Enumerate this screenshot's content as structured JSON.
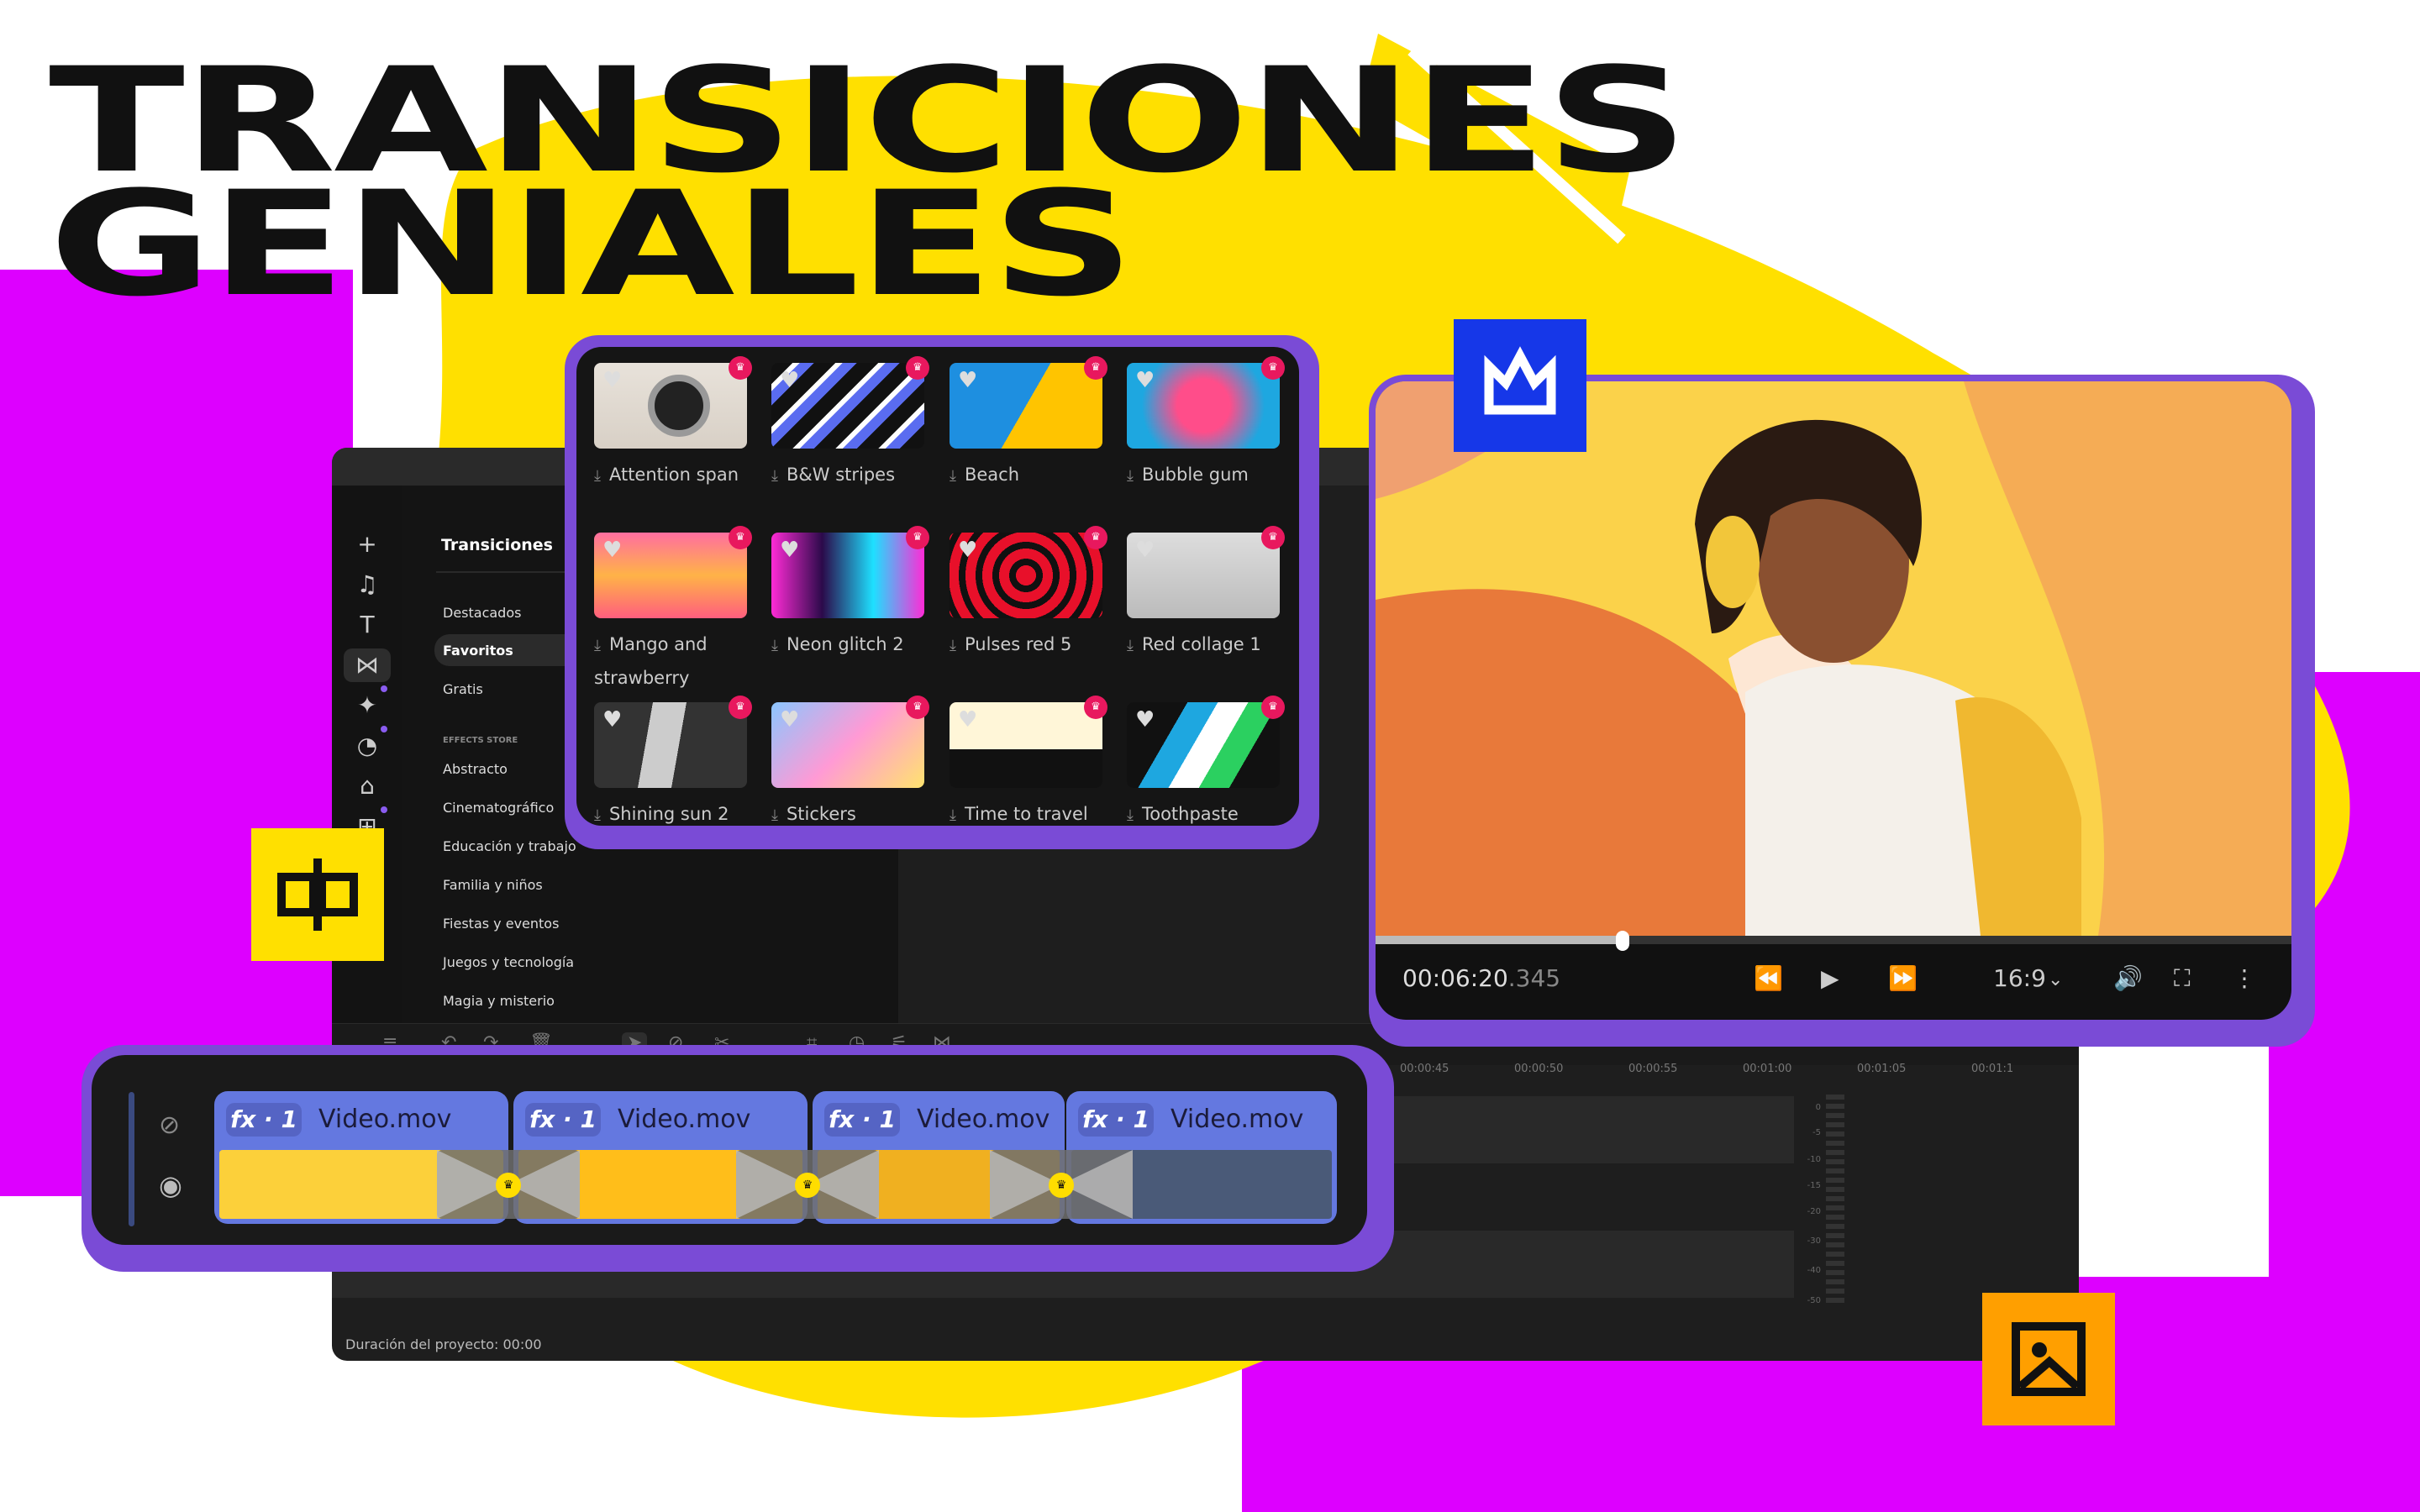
{
  "headline": {
    "line1": "TRANSICIONES",
    "line2": "GENIALES"
  },
  "colors": {
    "magenta": "#dd00ff",
    "yellow": "#ffe000",
    "purple": "#7a4bd6",
    "blue_badge": "#1637e8",
    "orange_badge": "#ff9f00",
    "clip_blue": "#6478e0",
    "premium_pink": "#e8185e"
  },
  "sidebar": {
    "icons": [
      "plus-icon",
      "music-icon",
      "text-icon",
      "transitions-icon",
      "effects-icon",
      "stickers-icon",
      "media-add-icon",
      "apps-icon"
    ]
  },
  "categories": {
    "title": "Transiciones",
    "items": [
      "Destacados",
      "Favoritos",
      "Gratis"
    ],
    "selected": "Favoritos",
    "store_label": "EFFECTS STORE",
    "store_items": [
      "Abstracto",
      "Cinematográfico",
      "Educación y trabajo",
      "Familia y niños",
      "Fiestas y eventos",
      "Juegos y tecnología",
      "Magia y misterio"
    ]
  },
  "effects": [
    {
      "name": "Attention span",
      "bg": "linear-gradient(#e8e2da,#d8d0c6)"
    },
    {
      "name": "B&W stripes",
      "bg": "repeating-linear-gradient(135deg,#111 0 18px,#fff 18px 24px,#5a6cf0 24px 36px)"
    },
    {
      "name": "Beach",
      "bg": "linear-gradient(120deg,#1e8fe0 50%,#ffc400 50%)"
    },
    {
      "name": "Bubble gum",
      "bg": "radial-gradient(circle at 50% 50%,#ff4d8a 30%,#1ea7e0 70%)"
    },
    {
      "name": "Mango and strawberry",
      "bg": "linear-gradient(#ff6ea0,#ffb347 50%,#ff5e7e)"
    },
    {
      "name": "Neon glitch 2",
      "bg": "linear-gradient(90deg,#ff2bd6,#2b0a4a,#1ee0ff,#ff2bd6)"
    },
    {
      "name": "Pulses red 5",
      "bg": "repeating-radial-gradient(circle,#e8102a 0 12px,#111 12px 20px)"
    },
    {
      "name": "Red collage 1",
      "bg": "linear-gradient(#ddd,#bbb)"
    },
    {
      "name": "Shining sun 2",
      "bg": "linear-gradient(100deg,#333 35%,#ccc 35% 55%,#333 55%)"
    },
    {
      "name": "Stickers",
      "bg": "linear-gradient(135deg,#8bc6ff,#ff9ad5,#ffe36e)"
    },
    {
      "name": "Time to travel",
      "bg": "linear-gradient(#fff6d8 55%,#111 55%)"
    },
    {
      "name": "Toothpaste",
      "bg": "linear-gradient(120deg,#111 30%,#1ea7e0 30% 45%,#fff 45% 60%,#2bd060 60% 75%,#111 75%)"
    }
  ],
  "player": {
    "timecode_main": "00:06:20",
    "timecode_ms": ".345",
    "aspect_ratio": "16:9",
    "progress_percent": 27
  },
  "timeline": {
    "ruler": [
      "00:00:45",
      "00:00:50",
      "00:00:55",
      "00:01:00",
      "00:01:05",
      "00:01:1"
    ],
    "meter": [
      "0",
      "-5",
      "-10",
      "-15",
      "-20",
      "-30",
      "-40",
      "-50"
    ],
    "duration": "Duración del proyecto: 00:00",
    "clips": [
      {
        "fx": "fx · 1",
        "name": "Video.mov"
      },
      {
        "fx": "fx · 1",
        "name": "Video.mov"
      },
      {
        "fx": "fx · 1",
        "name": "Video.mov"
      },
      {
        "fx": "fx · 1",
        "name": "Video.mov"
      }
    ]
  }
}
